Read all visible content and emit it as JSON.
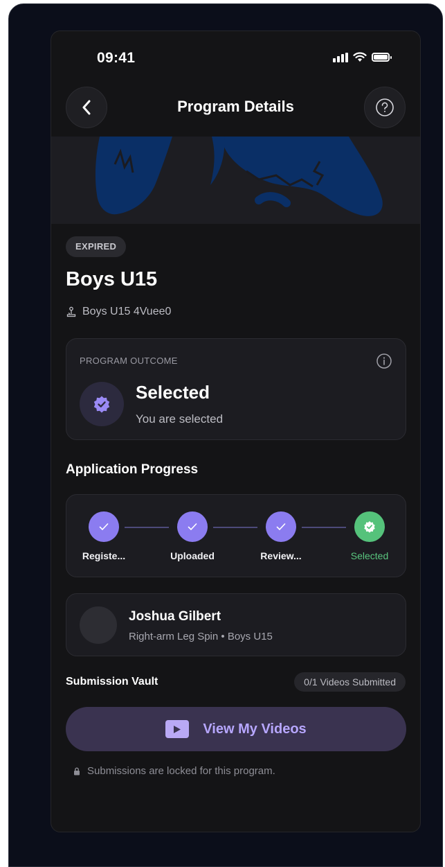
{
  "status_bar": {
    "time": "09:41",
    "icons": [
      "signal-icon",
      "wifi-icon",
      "battery-icon"
    ]
  },
  "nav": {
    "title": "Program Details",
    "back_icon": "chevron-left-icon",
    "help_icon": "help-circle-icon"
  },
  "program": {
    "status_badge": "EXPIRED",
    "title": "Boys U15",
    "subtitle": "Boys U15 4Vuee0"
  },
  "outcome": {
    "label": "PROGRAM OUTCOME",
    "title": "Selected",
    "text": "You are selected"
  },
  "progress": {
    "section_title": "Application Progress",
    "steps": [
      {
        "label": "Registe...",
        "state": "done"
      },
      {
        "label": "Uploaded",
        "state": "done"
      },
      {
        "label": "Review...",
        "state": "done"
      },
      {
        "label": "Selected",
        "state": "selected"
      }
    ]
  },
  "profile": {
    "name": "Joshua Gilbert",
    "meta": "Right-arm Leg Spin • Boys U15"
  },
  "vault": {
    "title": "Submission Vault",
    "badge": "0/1 Videos Submitted",
    "button_label": "View My Videos",
    "lock_note": "Submissions are locked for this program."
  },
  "colors": {
    "accent": "#8b7cf0",
    "success": "#55c27b",
    "background": "#141416",
    "card": "#1c1c21"
  }
}
